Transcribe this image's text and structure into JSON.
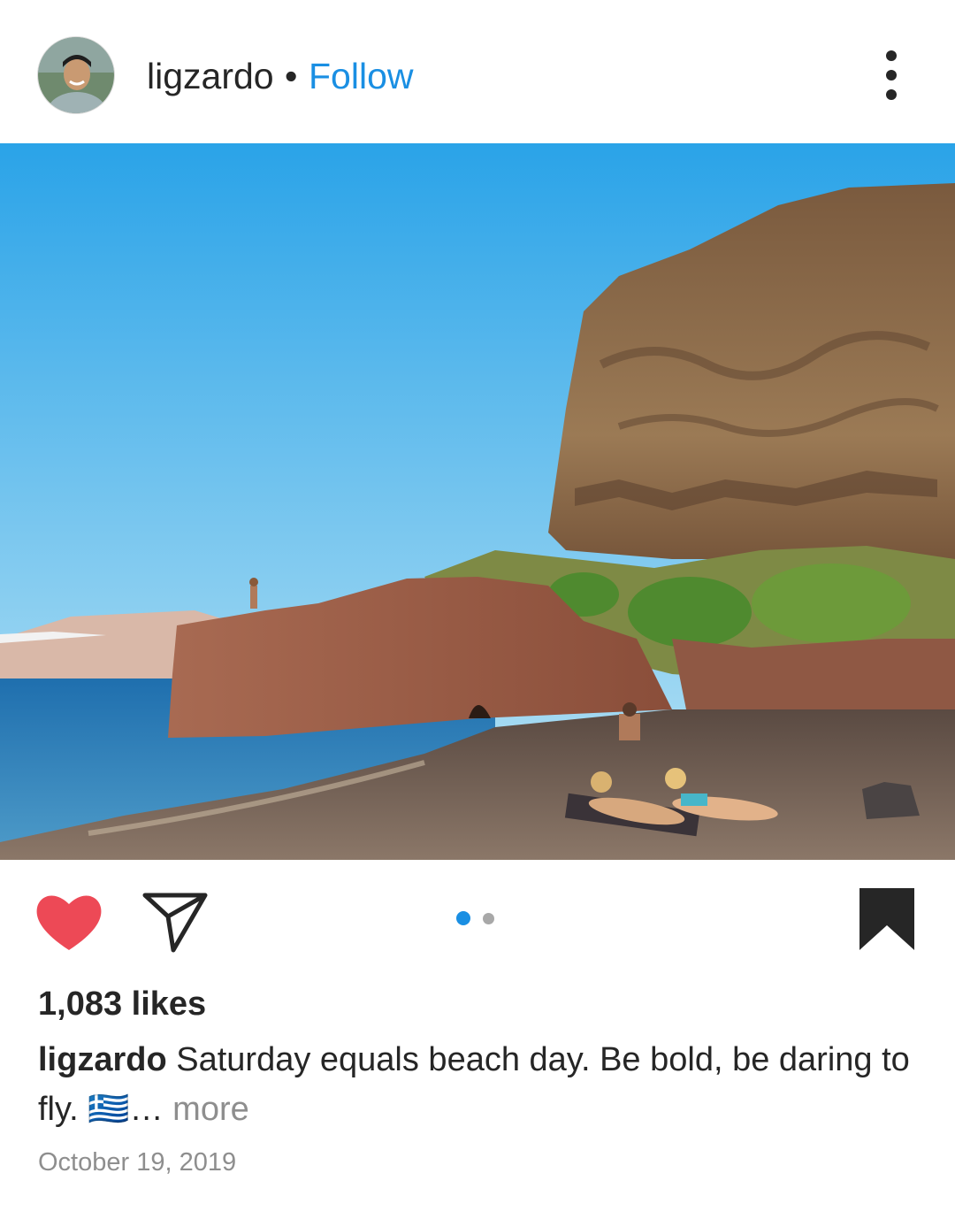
{
  "post": {
    "username": "ligzardo",
    "separator": "•",
    "follow_label": "Follow",
    "likes": "1,083 likes",
    "caption_user": "ligzardo",
    "caption_text": "Saturday equals beach day. Be bold, be daring to fly. 🇬🇷",
    "caption_ellipsis": "…",
    "more_label": "more",
    "date": "October 19, 2019"
  },
  "carousel": {
    "current": 1,
    "total": 2
  },
  "colors": {
    "accent": "#1a8fe3",
    "like": "#ed4956",
    "text": "#262626",
    "muted": "#8e8e8e"
  },
  "icons": [
    "more-options-icon",
    "heart-icon",
    "share-icon",
    "bookmark-icon"
  ]
}
